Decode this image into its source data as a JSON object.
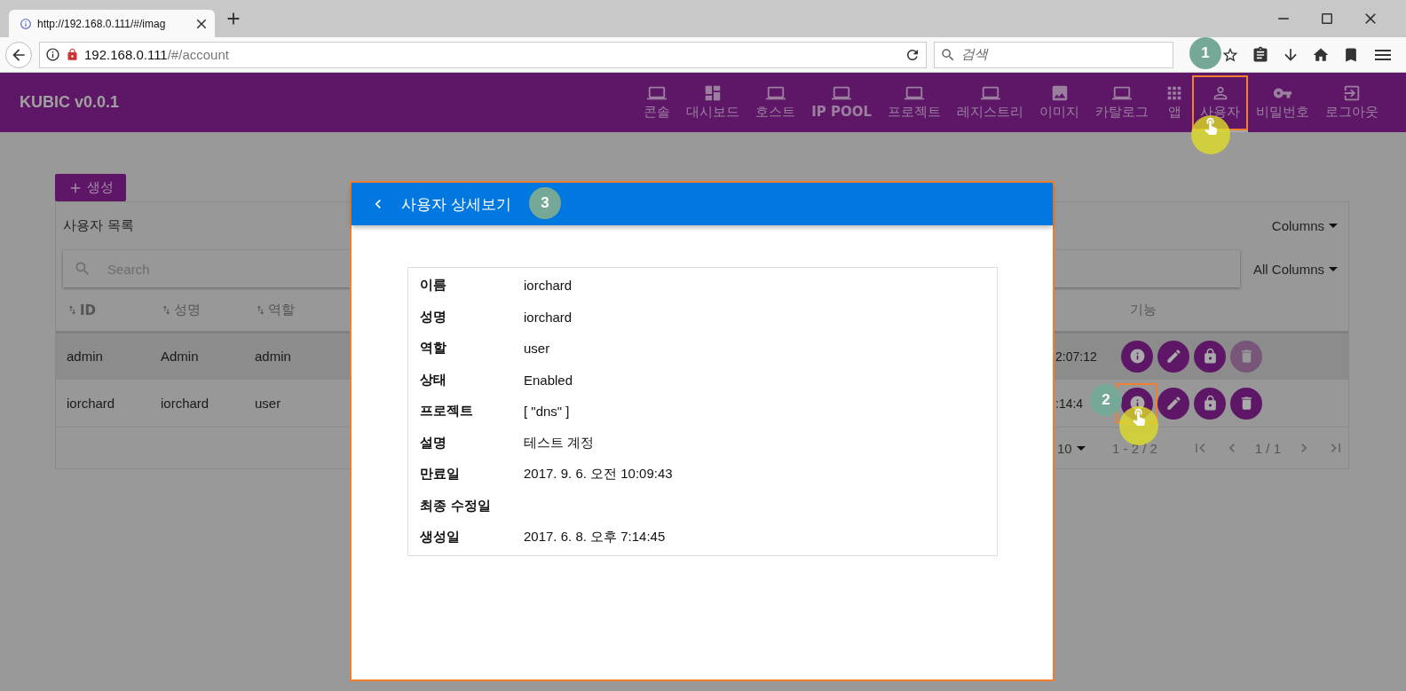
{
  "browser": {
    "tab_title": "http://192.168.0.111/#/imag",
    "url_host": "192.168.0.111",
    "url_path": "/#/account",
    "search_placeholder": "검색"
  },
  "navbar": {
    "brand": "KUBIC v0.0.1",
    "items": [
      {
        "label": "콘솔",
        "selected": false
      },
      {
        "label": "대시보드",
        "selected": false
      },
      {
        "label": "호스트",
        "selected": false
      },
      {
        "label": "IP POOL",
        "selected": false
      },
      {
        "label": "프로젝트",
        "selected": false
      },
      {
        "label": "레지스트리",
        "selected": false
      },
      {
        "label": "이미지",
        "selected": false
      },
      {
        "label": "카탈로그",
        "selected": false
      },
      {
        "label": "앱",
        "selected": false
      },
      {
        "label": "사용자",
        "selected": true
      },
      {
        "label": "비밀번호",
        "selected": false
      },
      {
        "label": "로그아웃",
        "selected": false
      }
    ]
  },
  "create_button": "생성",
  "user_list": {
    "title": "사용자 목록",
    "columns_menu": "Columns",
    "search_placeholder": "Search",
    "search_scope": "All Columns",
    "columns": [
      "ID",
      "성명",
      "역할"
    ],
    "actions_header": "기능",
    "rows": [
      {
        "cells": [
          "admin",
          "Admin",
          "admin"
        ],
        "time": "2:07:12",
        "selected": true,
        "delete_disabled": true
      },
      {
        "cells": [
          "iorchard",
          "iorchard",
          "user"
        ],
        "time": ":14:4",
        "selected": false,
        "delete_disabled": false
      }
    ],
    "page_size": "10",
    "range": "1 - 2 / 2",
    "page": "1 / 1"
  },
  "dialog": {
    "title": "사용자 상세보기",
    "fields": [
      {
        "label": "이름",
        "value": "iorchard"
      },
      {
        "label": "성명",
        "value": "iorchard"
      },
      {
        "label": "역할",
        "value": "user"
      },
      {
        "label": "상태",
        "value": "Enabled"
      },
      {
        "label": "프로젝트",
        "value": "[ \"dns\" ]"
      },
      {
        "label": "설명",
        "value": "테스트 계정"
      },
      {
        "label": "만료일",
        "value": "2017. 9. 6. 오전 10:09:43"
      },
      {
        "label": "최종 수정일"
      },
      {
        "label": "생성일",
        "value": "2017. 6. 8. 오후 7:14:45"
      }
    ]
  },
  "annotations": [
    {
      "label": "1"
    },
    {
      "label": "2"
    },
    {
      "label": "3"
    }
  ]
}
